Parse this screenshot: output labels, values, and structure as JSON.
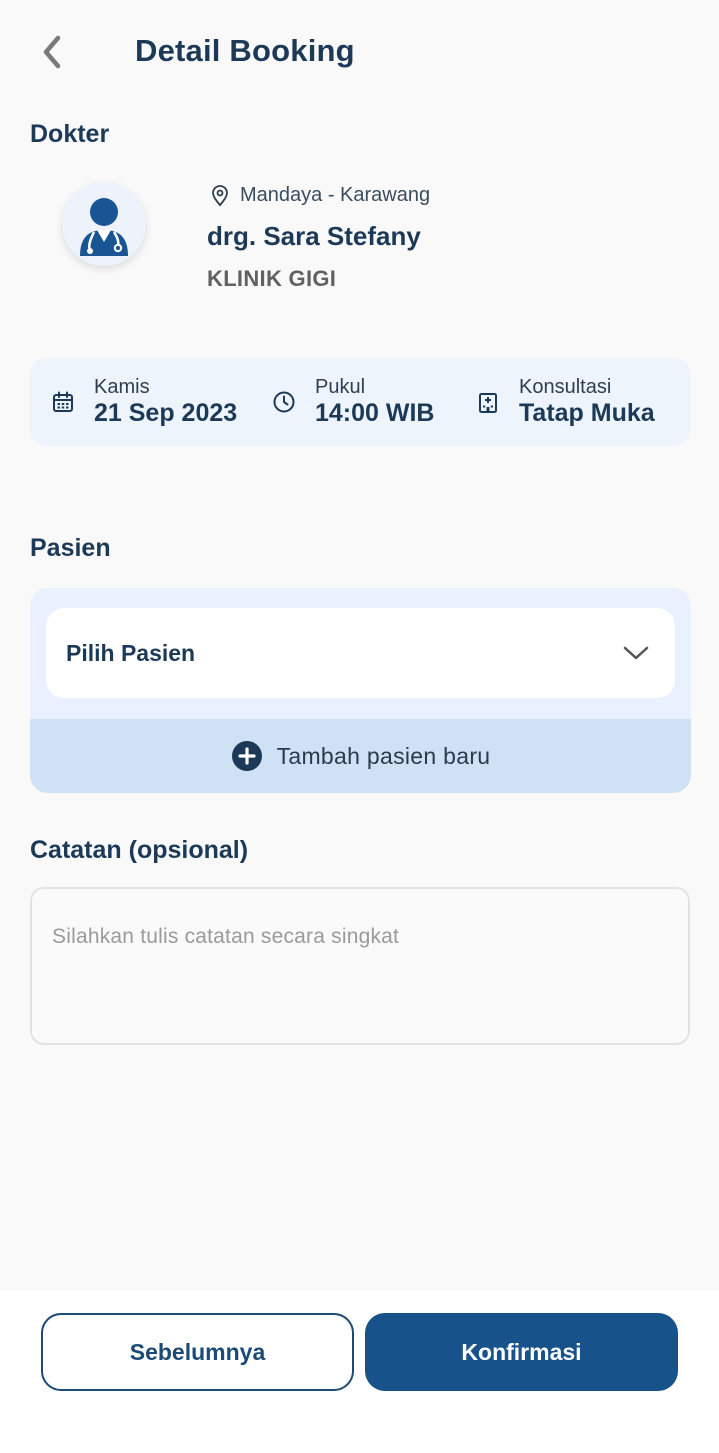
{
  "header": {
    "title": "Detail Booking"
  },
  "doctor_section": {
    "label": "Dokter",
    "location": "Mandaya - Karawang",
    "name": "drg. Sara Stefany",
    "specialty": "KLINIK GIGI"
  },
  "schedule": {
    "day_label": "Kamis",
    "date": "21 Sep 2023",
    "time_label": "Pukul",
    "time": "14:00 WIB",
    "consult_label": "Konsultasi",
    "consult_type": "Tatap Muka"
  },
  "patient_section": {
    "label": "Pasien",
    "select_value": "Pilih Pasien",
    "add_label": "Tambah pasien baru"
  },
  "notes_section": {
    "label": "Catatan (opsional)",
    "placeholder": "Silahkan tulis catatan secara singkat"
  },
  "footer": {
    "prev_label": "Sebelumnya",
    "confirm_label": "Konfirmasi"
  },
  "colors": {
    "primary": "#17528a",
    "text_dark": "#1c3a57",
    "card_bg": "#eef4fc",
    "add_bg": "#d1e1f5"
  }
}
